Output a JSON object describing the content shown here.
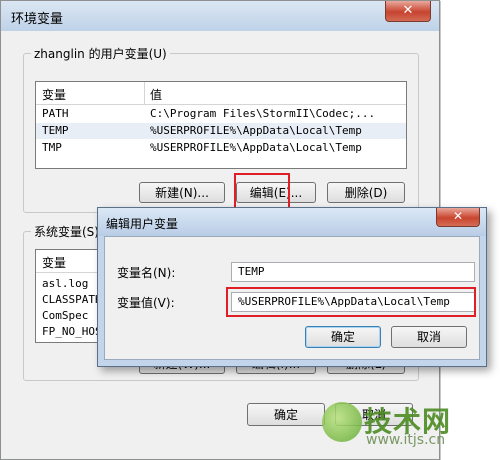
{
  "env_window": {
    "title": "环境变量",
    "close": "✕",
    "user_group_label": "zhanglin 的用户变量(U)",
    "user_columns": [
      "变量",
      "值"
    ],
    "user_rows": [
      {
        "name": "PATH",
        "value": "C:\\Program Files\\StormII\\Codec;..."
      },
      {
        "name": "TEMP",
        "value": "%USERPROFILE%\\AppData\\Local\\Temp"
      },
      {
        "name": "TMP",
        "value": "%USERPROFILE%\\AppData\\Local\\Temp"
      }
    ],
    "user_buttons": {
      "new": "新建(N)...",
      "edit": "编辑(E)...",
      "delete": "删除(D)"
    },
    "system_group_label": "系统变量(S)",
    "system_columns": [
      "变量"
    ],
    "system_rows": [
      "asl.log",
      "CLASSPATH",
      "ComSpec",
      "FP_NO_HOST_C"
    ],
    "system_buttons": {
      "new": "新建(W)...",
      "edit": "编辑(I)...",
      "delete": "删除(L)"
    },
    "ok": "确定",
    "cancel": "取消"
  },
  "edit_dialog": {
    "title": "编辑用户变量",
    "close": "✕",
    "name_label": "变量名(N):",
    "name_value": "TEMP",
    "value_label": "变量值(V):",
    "value_value": "%USERPROFILE%\\AppData\\Local\\Temp",
    "ok": "确定",
    "cancel": "取消"
  },
  "watermark": {
    "brand": "技术网",
    "url": "www.itjs.cn"
  },
  "colors": {
    "highlight": "#e01e26",
    "titlebar": "#bfd2e8",
    "watermark": "#4c8c22"
  }
}
